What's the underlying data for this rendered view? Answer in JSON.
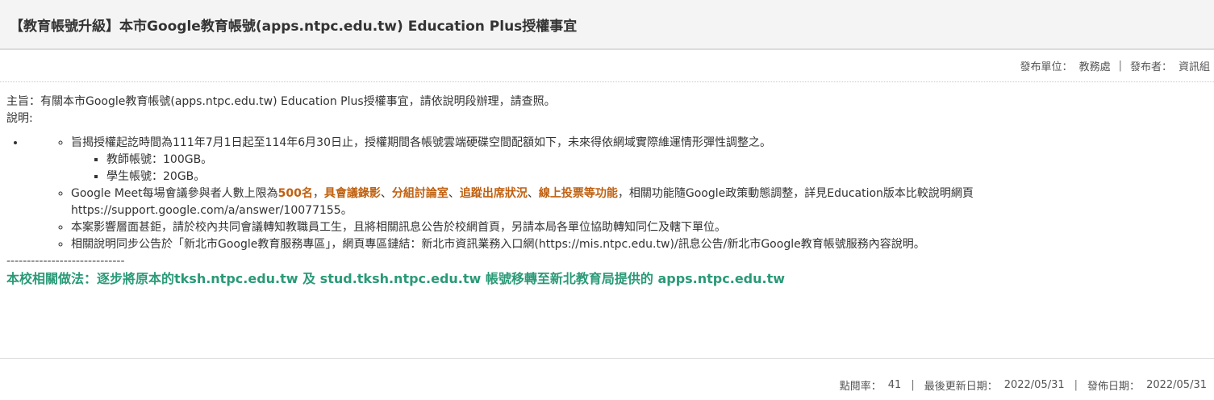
{
  "title": "【教育帳號升級】本市Google教育帳號(apps.ntpc.edu.tw) Education Plus授權事宜",
  "meta": {
    "unit_label": "發布單位：",
    "unit_value": "教務處",
    "separator": "|",
    "publisher_label": "發布者：",
    "publisher_value": "資訊組"
  },
  "content": {
    "subject": "主旨：有關本市Google教育帳號(apps.ntpc.edu.tw) Education Plus授權事宜，請依說明段辦理，請查照。",
    "explain_label": "說明:",
    "item1": "旨揭授權起訖時間為111年7月1日起至114年6月30日止，授權期間各帳號雲端硬碟空間配額如下，未來得依網域實際維運情形彈性調整之。",
    "item1_sub1": "教師帳號：100GB。",
    "item1_sub2": "學生帳號：20GB。",
    "item2_a": "Google Meet每場會議參與者人數上限為",
    "item2_b": "500名",
    "item2_c": "，",
    "item2_d": "具會議錄影",
    "item2_e": "、",
    "item2_f": "分組討論室",
    "item2_g": "、",
    "item2_h": "追蹤出席狀況",
    "item2_i": "、",
    "item2_j": "線上投票等功能",
    "item2_k": "，相關功能隨Google政策動態調整，詳見Education版本比較說明網頁https://support.google.com/a/answer/10077155。",
    "item3": "本案影響層面甚鉅，請於校內共同會議轉知教職員工生，且將相關訊息公告於校網首頁，另請本局各單位協助轉知同仁及轄下單位。",
    "item4": "相關說明同步公告於「新北市Google教育服務專區」，網頁專區鏈結：新北市資訊業務入口網(https://mis.ntpc.edu.tw)/訊息公告/新北市Google教育帳號服務內容說明。",
    "divider": "-----------------------------",
    "practice": "本校相關做法：逐步將原本的tksh.ntpc.edu.tw 及 stud.tksh.ntpc.edu.tw 帳號移轉至新北教育局提供的 apps.ntpc.edu.tw"
  },
  "footer": {
    "clicks_label": "點閱率：",
    "clicks_value": "41",
    "updated_label": "最後更新日期：",
    "updated_value": "2022/05/31",
    "published_label": "發佈日期：",
    "published_value": "2022/05/31",
    "separator": "|"
  },
  "colors": {
    "highlight": "#c0600f",
    "practice": "#2a9a77",
    "title_bg": "#f4f4f4"
  }
}
